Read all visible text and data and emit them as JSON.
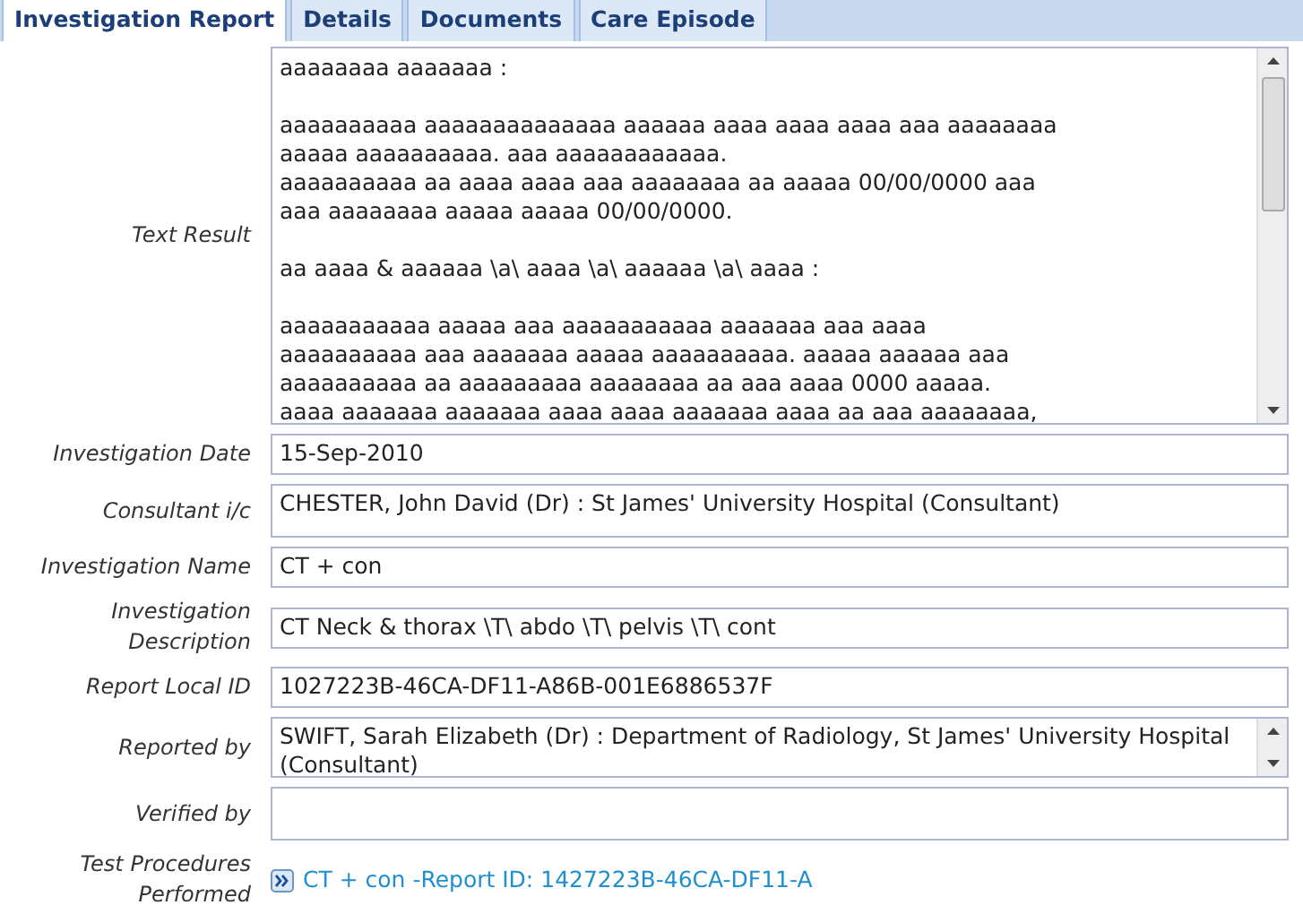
{
  "tabs": [
    {
      "label": "Investigation Report",
      "selected": true
    },
    {
      "label": "Details",
      "selected": false
    },
    {
      "label": "Documents",
      "selected": false
    },
    {
      "label": "Care Episode",
      "selected": false
    }
  ],
  "fields": [
    {
      "label": "Text Result",
      "kind": "textarea",
      "value": "aaaaaaaa aaaaaaa :\n\naaaaaaaaaa aaaaaaaaaaaaaa aaaaaa aaaa aaaa aaaa aaa aaaaaaaa\naaaaa aaaaaaaaaa. aaa aaaaaaaaaaaa.\naaaaaaaaaa aa aaaa aaaa aaa aaaaaaaa aa aaaaa 00/00/0000 aaa\naaa aaaaaaaa aaaaa aaaaa 00/00/0000.\n\naa aaaa & aaaaaa \\a\\ aaaa \\a\\ aaaaaa \\a\\ aaaa :\n\naaaaaaaaaaa aaaaa aaa aaaaaaaaaaa aaaaaaa aaa aaaa\naaaaaaaaaa aaa aaaaaaa aaaaa aaaaaaaaaa. aaaaa aaaaaa aaa\naaaaaaaaaa aa aaaaaaaaa aaaaaaaa aa aaa aaaa 0000 aaaaa.\naaaa aaaaaaa aaaaaaa aaaa aaaa aaaaaaa aaaa aa aaa aaaaaaaa,"
    },
    {
      "label": "Investigation Date",
      "kind": "text",
      "value": "15-Sep-2010"
    },
    {
      "label": "Consultant i/c",
      "kind": "tall",
      "value": "CHESTER, John David (Dr) : St James' University Hospital (Consultant)"
    },
    {
      "label": "Investigation Name",
      "kind": "text",
      "value": "CT + con"
    },
    {
      "label": "Investigation Description",
      "kind": "text",
      "value": "CT Neck & thorax \\T\\ abdo \\T\\ pelvis \\T\\ cont"
    },
    {
      "label": "Report Local ID",
      "kind": "text",
      "value": "1027223B-46CA-DF11-A86B-001E6886537F"
    },
    {
      "label": "Reported by",
      "kind": "scroll",
      "value": "SWIFT, Sarah Elizabeth (Dr) : Department of Radiology, St James' University Hospital (Consultant)"
    },
    {
      "label": "Verified by",
      "kind": "tall"
    },
    {
      "label": "Test Procedures Performed",
      "kind": "link",
      "value": "CT + con -Report ID: 1427223B-46CA-DF11-A"
    }
  ]
}
